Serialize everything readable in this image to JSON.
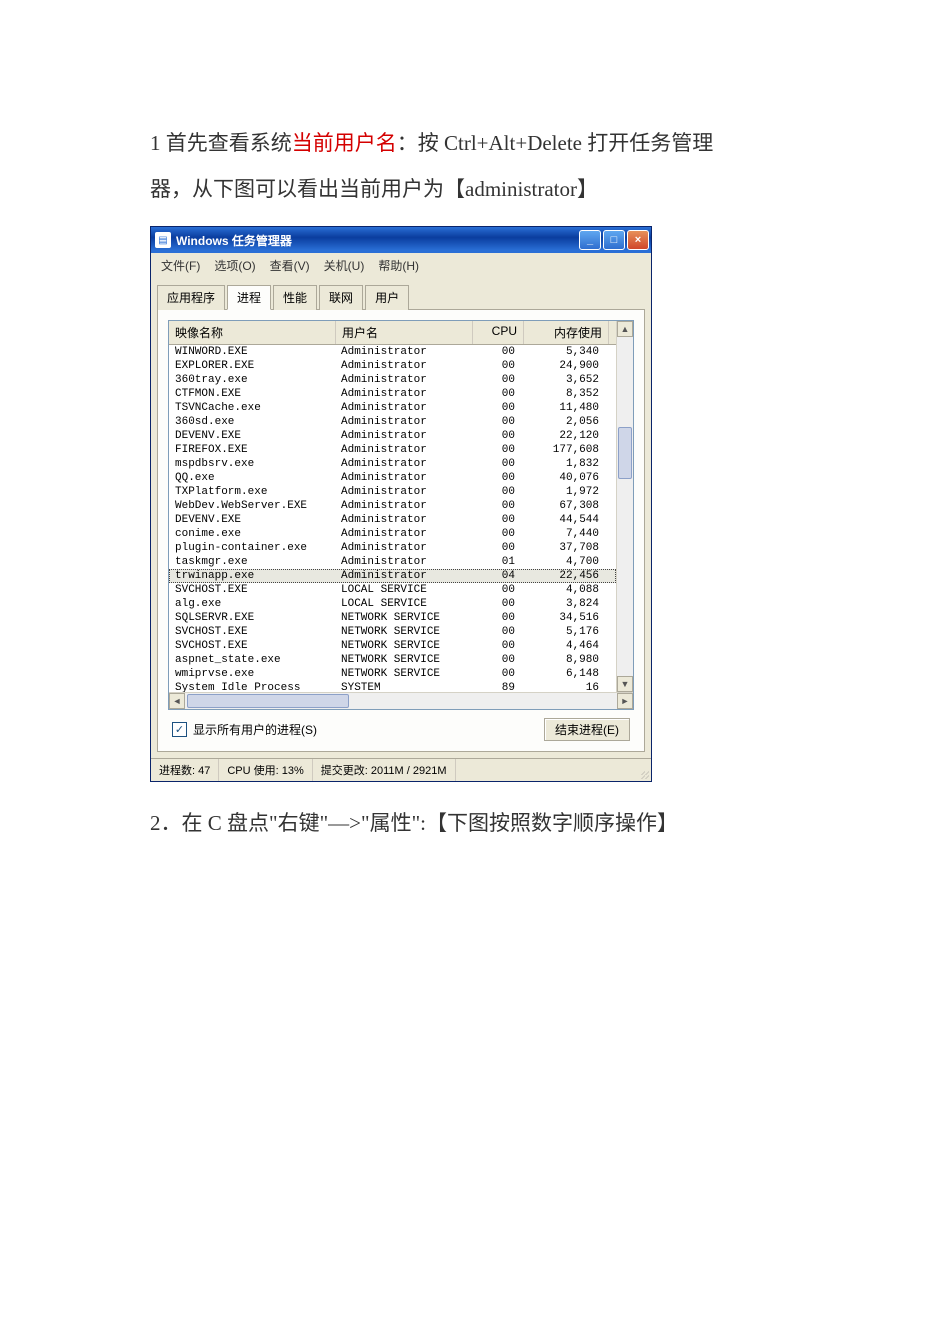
{
  "intro": {
    "line1_pre": "1 首先查看系统",
    "line1_red": "当前用户名",
    "line1_post": "：按 Ctrl+Alt+Delete 打开任务管理",
    "line2": "器，从下图可以看出当前用户为【administrator】"
  },
  "taskmgr": {
    "title": "Windows 任务管理器",
    "menu": {
      "file": "文件(F)",
      "options": "选项(O)",
      "view": "查看(V)",
      "shutdown": "关机(U)",
      "help": "帮助(H)"
    },
    "tabs": {
      "apps": "应用程序",
      "proc": "进程",
      "perf": "性能",
      "net": "联网",
      "users": "用户"
    },
    "columns": {
      "image": "映像名称",
      "user": "用户名",
      "cpu": "CPU",
      "mem": "内存使用"
    },
    "processes": [
      {
        "name": "WINWORD.EXE",
        "user": "Administrator",
        "cpu": "00",
        "mem": "5,340"
      },
      {
        "name": "EXPLORER.EXE",
        "user": "Administrator",
        "cpu": "00",
        "mem": "24,900"
      },
      {
        "name": "360tray.exe",
        "user": "Administrator",
        "cpu": "00",
        "mem": "3,652"
      },
      {
        "name": "CTFMON.EXE",
        "user": "Administrator",
        "cpu": "00",
        "mem": "8,352"
      },
      {
        "name": "TSVNCache.exe",
        "user": "Administrator",
        "cpu": "00",
        "mem": "11,480"
      },
      {
        "name": "360sd.exe",
        "user": "Administrator",
        "cpu": "00",
        "mem": "2,056"
      },
      {
        "name": "DEVENV.EXE",
        "user": "Administrator",
        "cpu": "00",
        "mem": "22,120"
      },
      {
        "name": "FIREFOX.EXE",
        "user": "Administrator",
        "cpu": "00",
        "mem": "177,608"
      },
      {
        "name": "mspdbsrv.exe",
        "user": "Administrator",
        "cpu": "00",
        "mem": "1,832"
      },
      {
        "name": "QQ.exe",
        "user": "Administrator",
        "cpu": "00",
        "mem": "40,076"
      },
      {
        "name": "TXPlatform.exe",
        "user": "Administrator",
        "cpu": "00",
        "mem": "1,972"
      },
      {
        "name": "WebDev.WebServer.EXE",
        "user": "Administrator",
        "cpu": "00",
        "mem": "67,308"
      },
      {
        "name": "DEVENV.EXE",
        "user": "Administrator",
        "cpu": "00",
        "mem": "44,544"
      },
      {
        "name": "conime.exe",
        "user": "Administrator",
        "cpu": "00",
        "mem": "7,440"
      },
      {
        "name": "plugin-container.exe",
        "user": "Administrator",
        "cpu": "00",
        "mem": "37,708"
      },
      {
        "name": "taskmgr.exe",
        "user": "Administrator",
        "cpu": "01",
        "mem": "4,700"
      },
      {
        "name": "trwinapp.exe",
        "user": "Administrator",
        "cpu": "04",
        "mem": "22,456",
        "selected": true
      },
      {
        "name": "SVCHOST.EXE",
        "user": "LOCAL SERVICE",
        "cpu": "00",
        "mem": "4,088"
      },
      {
        "name": "alg.exe",
        "user": "LOCAL SERVICE",
        "cpu": "00",
        "mem": "3,824"
      },
      {
        "name": "SQLSERVR.EXE",
        "user": "NETWORK SERVICE",
        "cpu": "00",
        "mem": "34,516"
      },
      {
        "name": "SVCHOST.EXE",
        "user": "NETWORK SERVICE",
        "cpu": "00",
        "mem": "5,176"
      },
      {
        "name": "SVCHOST.EXE",
        "user": "NETWORK SERVICE",
        "cpu": "00",
        "mem": "4,464"
      },
      {
        "name": "aspnet_state.exe",
        "user": "NETWORK SERVICE",
        "cpu": "00",
        "mem": "8,980"
      },
      {
        "name": "wmiprvse.exe",
        "user": "NETWORK SERVICE",
        "cpu": "00",
        "mem": "6,148"
      },
      {
        "name": "System Idle Process",
        "user": "SYSTEM",
        "cpu": "89",
        "mem": "16"
      }
    ],
    "show_all_users": "显示所有用户的进程(S)",
    "end_process": "结束进程(E)",
    "status": {
      "proc_count": "进程数: 47",
      "cpu_usage": "CPU 使用: 13%",
      "commit": "提交更改: 2011M / 2921M"
    }
  },
  "step2": "2．在 C 盘点\"右键\"—>\"属性\":【下图按照数字顺序操作】"
}
